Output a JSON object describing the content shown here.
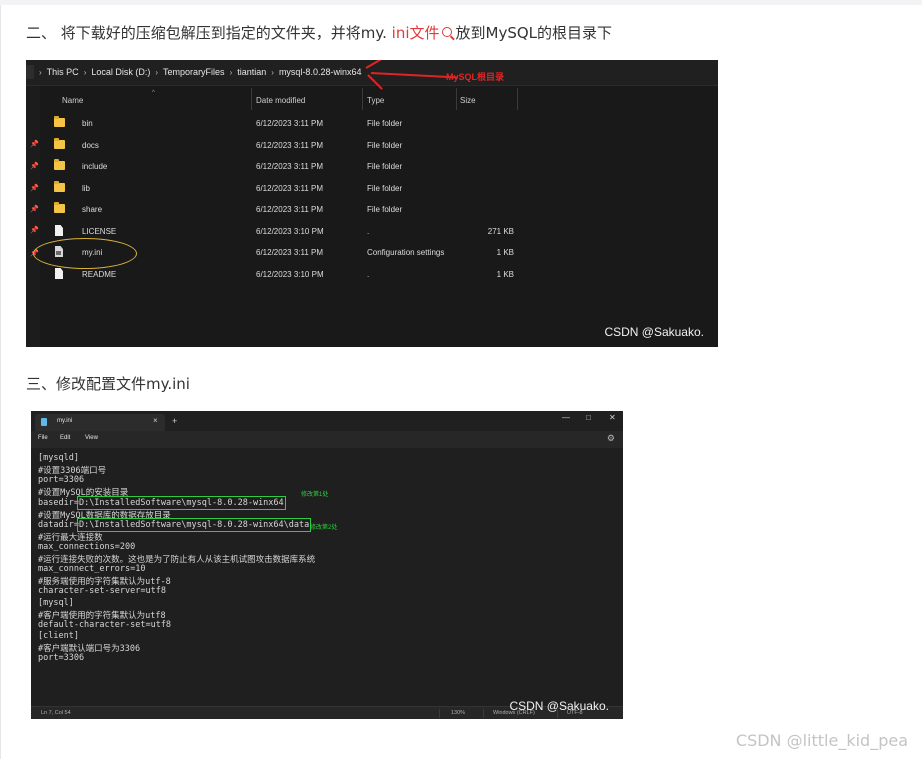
{
  "step2": {
    "prefix": "二、 将下载好的压缩包解压到指定的文件夹，并将my. ",
    "link": "ini文件",
    "suffix": "放到MySQL的根目录下"
  },
  "explorer": {
    "breadcrumb": [
      "This PC",
      "Local Disk (D:)",
      "TemporaryFiles",
      "tiantian",
      "mysql-8.0.28-winx64"
    ],
    "annotation": "MySQL根目录",
    "columns": {
      "name": "Name",
      "date": "Date modified",
      "type": "Type",
      "size": "Size"
    },
    "rows": [
      {
        "icon": "folder",
        "name": "bin",
        "date": "6/12/2023 3:11 PM",
        "type": "File folder",
        "size": ""
      },
      {
        "icon": "folder",
        "name": "docs",
        "date": "6/12/2023 3:11 PM",
        "type": "File folder",
        "size": ""
      },
      {
        "icon": "folder",
        "name": "include",
        "date": "6/12/2023 3:11 PM",
        "type": "File folder",
        "size": ""
      },
      {
        "icon": "folder",
        "name": "lib",
        "date": "6/12/2023 3:11 PM",
        "type": "File folder",
        "size": ""
      },
      {
        "icon": "folder",
        "name": "share",
        "date": "6/12/2023 3:11 PM",
        "type": "File folder",
        "size": ""
      },
      {
        "icon": "file",
        "name": "LICENSE",
        "date": "6/12/2023 3:10 PM",
        "type": ".",
        "size": "271 KB"
      },
      {
        "icon": "ini",
        "name": "my.ini",
        "date": "6/12/2023 3:11 PM",
        "type": "Configuration settings",
        "size": "1 KB"
      },
      {
        "icon": "file",
        "name": "README",
        "date": "6/12/2023 3:10 PM",
        "type": ".",
        "size": "1 KB"
      }
    ],
    "watermark": "CSDN @Sakuako."
  },
  "step3": {
    "text": "三、修改配置文件my.ini"
  },
  "notepad": {
    "tab_title": "my.ini",
    "tab_close": "×",
    "tab_add": "+",
    "win_min": "—",
    "win_max": "□",
    "win_close": "✕",
    "menu": {
      "file": "File",
      "edit": "Edit",
      "view": "View"
    },
    "lines": [
      {
        "text": "[mysqld]"
      },
      {
        "text": "#设置3306端口号"
      },
      {
        "text": "port=3306"
      },
      {
        "text": "#设置MySQL的安装目录"
      },
      {
        "pre": "basedir=",
        "boxed": "D:\\InstalledSoftware\\mysql-8.0.28-winx64"
      },
      {
        "text": "#设置MySQL数据库的数据存放目录"
      },
      {
        "pre": "datadir=",
        "boxed": "D:\\InstalledSoftware\\mysql-8.0.28-winx64\\data"
      },
      {
        "text": "#运行最大连接数"
      },
      {
        "text": "max_connections=200"
      },
      {
        "text": "#运行连接失败的次数。这也是为了防止有人从该主机试图攻击数据库系统"
      },
      {
        "text": "max_connect_errors=10"
      },
      {
        "text": "#服务端使用的字符集默认为utf-8"
      },
      {
        "text": "character-set-server=utf8"
      },
      {
        "text": "[mysql]"
      },
      {
        "text": "#客户端使用的字符集默认为utf8"
      },
      {
        "text": "default-character-set=utf8"
      },
      {
        "text": "[client]"
      },
      {
        "text": "#客户端默认端口号为3306"
      },
      {
        "text": "port=3306"
      }
    ],
    "note1": "修改第1处",
    "note2": "修改第2处",
    "status": {
      "position": "Ln 7, Col 54",
      "zoom": "130%",
      "line_ending": "Windows (CRLF)",
      "encoding": "UTF-8"
    },
    "watermark": "CSDN @Sakuako."
  },
  "page_watermark": "CSDN @little_kid_pea",
  "colors": {
    "link": "#e23a3a",
    "annotation": "#e02424",
    "highlight_box": "#2ecc40",
    "ellipse": "#d9b23a"
  }
}
